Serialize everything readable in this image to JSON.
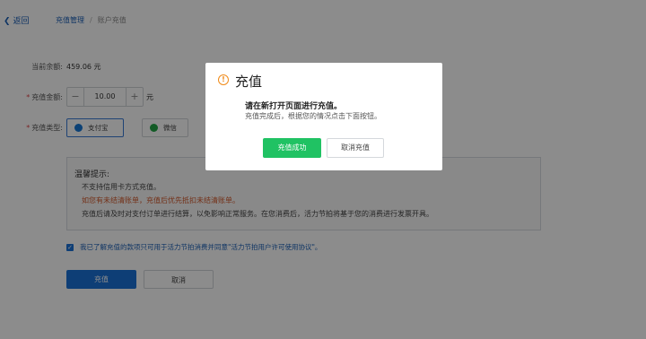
{
  "header": {
    "back_label": "返回",
    "breadcrumb": {
      "parent": "充值管理",
      "separator": "/",
      "current": "账户充值"
    }
  },
  "form": {
    "balance_label": "当前余额:",
    "balance_value": "459.06 元",
    "amount_label": "充值金额:",
    "amount_value": "10.00",
    "amount_minus": "−",
    "amount_plus": "+",
    "amount_unit": "元",
    "type_label": "充值类型:",
    "pay_options": [
      {
        "label": "支付宝",
        "icon": "alipay-icon",
        "selected": true
      },
      {
        "label": "微信",
        "icon": "wechat-icon",
        "selected": false
      }
    ]
  },
  "notice": {
    "title": "温馨提示:",
    "line1": "不支持信用卡方式充值。",
    "line2": "如您有未结清账单，充值后优先抵扣未结清账单。",
    "line3": "充值后请及时对支付订单进行结算，以免影响正常服务。在您消费后，活力节拍将基于您的消费进行发票开具。"
  },
  "agreement": {
    "checked": true,
    "text": "我已了解充值的款项只可用于活力节拍消费并同意\"活力节拍用户许可使用协议\"。"
  },
  "actions": {
    "submit_label": "充值",
    "cancel_label": "取消"
  },
  "modal": {
    "icon": "warning-icon",
    "title": "充值",
    "message": "请在新打开页面进行充值。",
    "sub_message": "充值完成后，根据您的情况点击下面按钮。",
    "ok_label": "充值成功",
    "cancel_label": "取消充值"
  },
  "colors": {
    "accent": "#1b72d8",
    "success": "#20c263",
    "warning": "#f08a18",
    "overlay": "rgba(0,0,0,0.45)"
  }
}
